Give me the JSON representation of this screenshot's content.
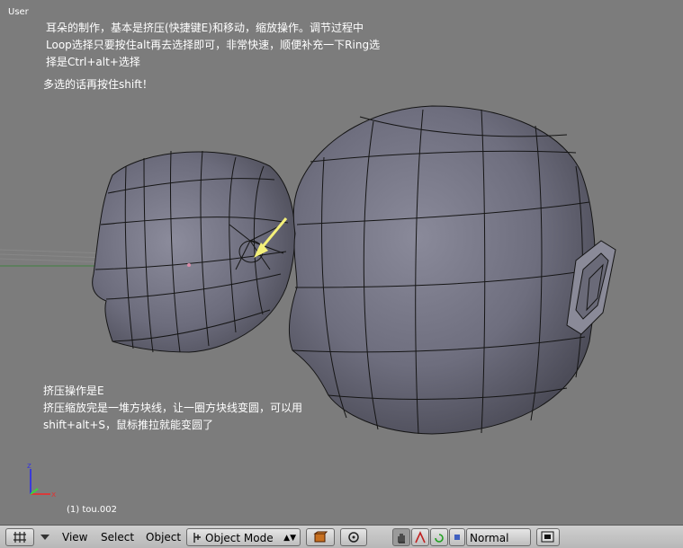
{
  "viewport": {
    "view_label": "User",
    "notes_top": [
      "耳朵的制作，基本是挤压(快捷键E)和移动，缩放操作。调节过程中",
      "Loop选择只要按住alt再去选择即可，非常快速，顺便补充一下Ring选",
      "择是Ctrl+alt+选择"
    ],
    "note_multi": "多选的话再按住shift！",
    "notes_bottom": [
      "挤压操作是E",
      "挤压缩放完是一堆方块线，让一圈方块线变圆，可以用",
      "shift+alt+S，鼠标推拉就能变圆了"
    ],
    "object_label": "(1) tou.002",
    "axis_labels": {
      "z": "z",
      "x": "x"
    }
  },
  "toolbar": {
    "menus": [
      "View",
      "Select",
      "Object"
    ],
    "mode_select": "Object Mode",
    "viewport_shade": "Normal",
    "icons": [
      "grid-editor-type-icon",
      "menu-collapse-icon",
      "object-mode-icon",
      "draw-type-icon",
      "pivot-icon",
      "hand-icon",
      "translate-icon",
      "rotate-icon",
      "scale-icon",
      "render-icon"
    ]
  },
  "colors": {
    "background": "#7c7c7c",
    "mesh_fill": "#737383",
    "mesh_wire": "#151515",
    "arrow": "#f4f07a",
    "toolbar": "#c6c6c6"
  }
}
